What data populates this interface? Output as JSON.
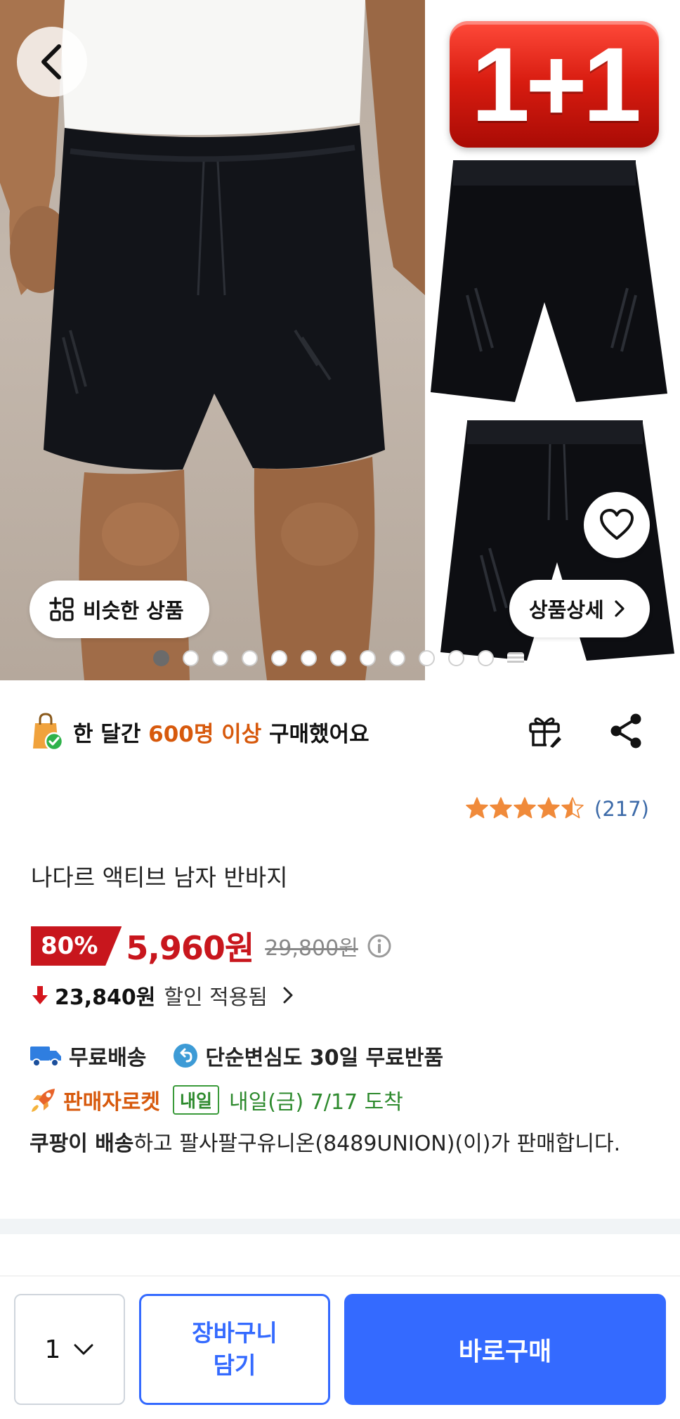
{
  "gallery": {
    "promo_badge": "1+1",
    "similar_label": "비슷한 상품",
    "detail_label": "상품상세",
    "dots_total": 12,
    "active_dot": 1
  },
  "popularity": {
    "prefix": "한 달간 ",
    "highlight": "600명 이상",
    "suffix": " 구매했어요"
  },
  "rating": {
    "stars": 4.5,
    "count": "(217)"
  },
  "product": {
    "title": "나다르 액티브 남자 반바지"
  },
  "price": {
    "discount": "80%",
    "sale": "5,960원",
    "original": "29,800원"
  },
  "saving": {
    "amount": "23,840원",
    "note": "할인 적용됨"
  },
  "shipping": {
    "free": "무료배송",
    "returns": "단순변심도 30일 무료반품",
    "rocket": "판매자로켓",
    "badge": "내일",
    "eta": "내일(금) 7/17 도착"
  },
  "seller": {
    "bold": "쿠팡이 배송",
    "rest": "하고 팔사팔구유니온(8489UNION)(이)가 판매합니다."
  },
  "bottom": {
    "qty": "1",
    "cart": "장바구니 담기",
    "buy": "바로구매"
  },
  "colors": {
    "accent": "#346aff",
    "sale": "#c8161d",
    "highlight": "#d7590c",
    "delivery": "#2d8a2d",
    "star": "#f08a3a"
  }
}
